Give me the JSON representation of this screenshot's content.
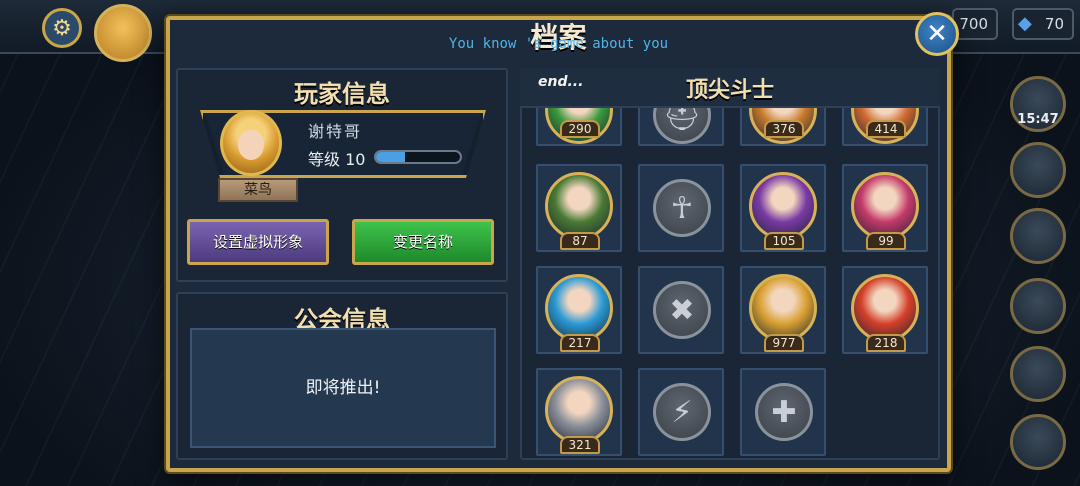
{
  "modal": {
    "title": "档案",
    "subtitle": "You know 's game about you",
    "close_label": "✕"
  },
  "player": {
    "heading": "玩家信息",
    "name": "谢特哥",
    "level_label": "等级 10",
    "level_progress": 0.35,
    "rank": "菜鸟",
    "set_avatar_label": "设置虚拟形象",
    "rename_label": "变更名称"
  },
  "guild": {
    "heading": "公会信息",
    "message": "即将推出!"
  },
  "fighters": {
    "tag": "end...",
    "heading": "顶尖斗士",
    "top_row": [
      {
        "score": "290",
        "locked": false,
        "color": "#3a9a3c"
      },
      {
        "score": "",
        "locked": true,
        "icon": "helmet-icon",
        "symbol": "⛑"
      },
      {
        "score": "376",
        "locked": false,
        "color": "#c77a2a"
      },
      {
        "score": "414",
        "locked": false,
        "color": "#cf6a30"
      }
    ],
    "rows": [
      [
        {
          "score": "87",
          "locked": false,
          "color": "#4a7a34"
        },
        {
          "score": "",
          "locked": true,
          "icon": "ankh-icon",
          "symbol": "☥"
        },
        {
          "score": "105",
          "locked": false,
          "color": "#7a3aa4"
        },
        {
          "score": "99",
          "locked": false,
          "color": "#c43a6a"
        }
      ],
      [
        {
          "score": "217",
          "locked": false,
          "color": "#2a9ad4"
        },
        {
          "score": "",
          "locked": true,
          "icon": "crossed-swords-icon",
          "symbol": "✖"
        },
        {
          "score": "977",
          "locked": false,
          "color": "#d9a030"
        },
        {
          "score": "218",
          "locked": false,
          "color": "#d4402a"
        }
      ],
      [
        {
          "score": "321",
          "locked": false,
          "color": "#8a8f9a"
        },
        {
          "score": "",
          "locked": true,
          "icon": "claw-icon",
          "symbol": "⚡"
        },
        {
          "score": "",
          "locked": true,
          "icon": "medic-cross-icon",
          "symbol": "✚"
        }
      ]
    ]
  },
  "hud": {
    "gold_amount": "700",
    "gem_amount": "70",
    "timer": "15:47"
  }
}
